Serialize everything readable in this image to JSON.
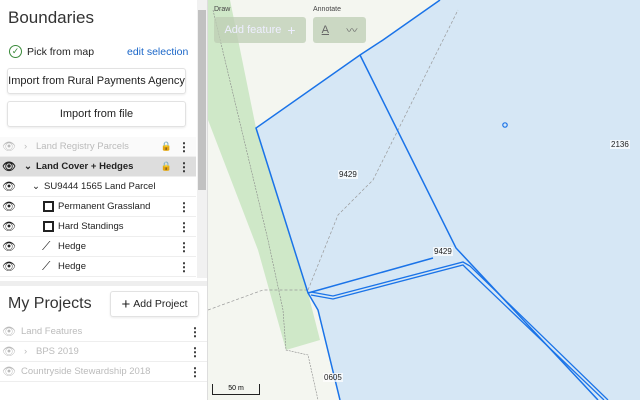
{
  "boundaries": {
    "title": "Boundaries",
    "pick_from_map": "Pick from map",
    "edit_selection": "edit selection",
    "import_rpa": "Import from Rural Payments Agency",
    "import_file": "Import from file"
  },
  "layers": [
    {
      "label": "Land Registry Parcels",
      "visible": false,
      "expanded": false,
      "locked": true,
      "icon": "chevron-right"
    },
    {
      "label": "Land Cover + Hedges",
      "visible": true,
      "expanded": true,
      "locked": true,
      "icon": "chevron-down"
    },
    {
      "label": "SU9444 1565 Land Parcel",
      "visible": true,
      "expanded": true,
      "icon": "chevron-down"
    },
    {
      "label": "Permanent Grassland",
      "visible": true,
      "icon": "polygon"
    },
    {
      "label": "Hard Standings",
      "visible": true,
      "icon": "polygon"
    },
    {
      "label": "Hedge",
      "visible": true,
      "icon": "line"
    },
    {
      "label": "Hedge",
      "visible": true,
      "icon": "line"
    }
  ],
  "projects": {
    "title": "My Projects",
    "add_label": "Add Project",
    "items": [
      {
        "label": "Land Features",
        "visible": false
      },
      {
        "label": "BPS 2019",
        "visible": false,
        "icon": "chevron-right"
      },
      {
        "label": "Countryside Stewardship 2018",
        "visible": false
      }
    ]
  },
  "toolbar": {
    "draw_label": "Draw",
    "add_feature": "Add feature",
    "annotate_label": "Annotate",
    "text_tool": "A"
  },
  "map": {
    "labels": [
      "9429",
      "9429",
      "2136",
      "0605"
    ],
    "scale": "50 m",
    "colors": {
      "parcel_fill": "#d6e7f5",
      "outline": "#1a73e8",
      "green": "#cfe8c8"
    }
  }
}
